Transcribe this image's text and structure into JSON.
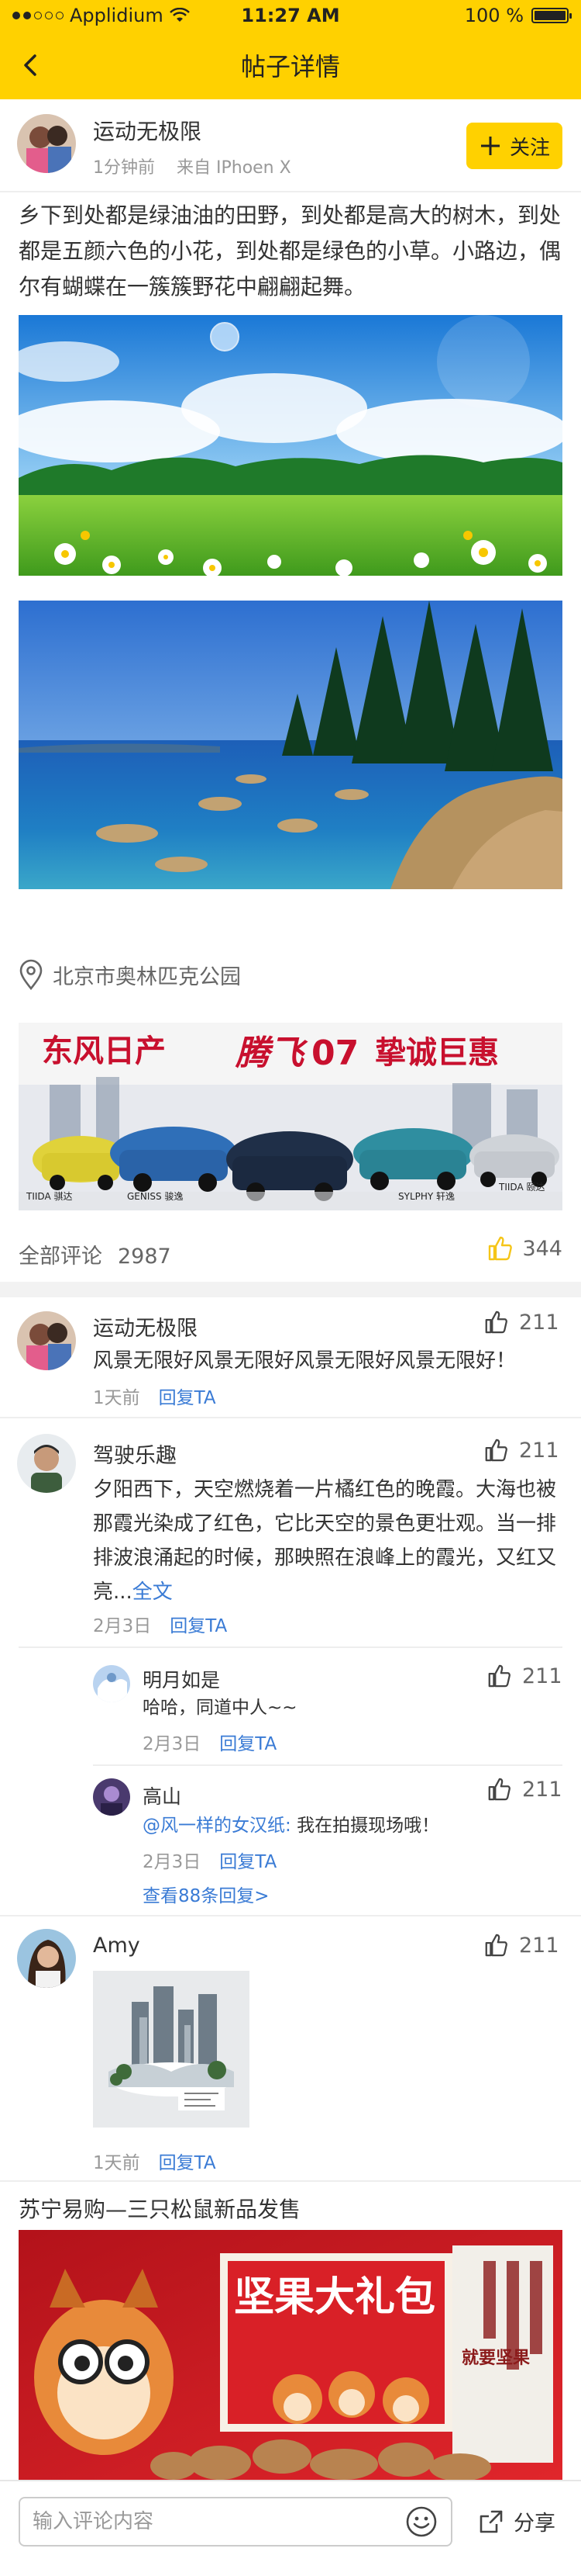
{
  "status": {
    "carrier": "Applidium",
    "time": "11:27 AM",
    "battery": "100 %"
  },
  "nav": {
    "title": "帖子详情"
  },
  "post": {
    "author": "运动无极限",
    "time": "1分钟前",
    "source": "来自 IPhoen X",
    "follow_label": "关注",
    "text": "乡下到处都是绿油油的田野，到处都是高大的树木，到处都是五颜六色的小花，到处都是绿色的小草。小路边，偶尔有蝴蝶在一簇簇野花中翩翩起舞。",
    "location": "北京市奥林匹克公园"
  },
  "ad_banner": {
    "brand": "东风日产",
    "slogan_script": "腾飞",
    "slogan_num": "07",
    "slogan_tail": "挚诚巨惠",
    "car_labels": [
      "TIIDA 骐达",
      "GENISS 骏逸",
      "SYLPHY 轩逸",
      "TIIDA 颐达"
    ]
  },
  "stats": {
    "comments_label": "全部评论",
    "comments_count": "2987",
    "likes": "344"
  },
  "comments": [
    {
      "name": "运动无极限",
      "text": "风景无限好风景无限好风景无限好风景无限好！",
      "time": "1天前",
      "reply_label": "回复TA",
      "likes": "211"
    },
    {
      "name": "驾驶乐趣",
      "text": "夕阳西下，天空燃烧着一片橘红色的晚霞。大海也被那霞光染成了红色，它比天空的景色更壮观。当一排排波浪涌起的时候，那映照在浪峰上的霞光，又红又亮...",
      "more": "全文",
      "time": "2月3日",
      "reply_label": "回复TA",
      "likes": "211",
      "replies": [
        {
          "name": "明月如是",
          "text": "哈哈，同道中人~~",
          "time": "2月3日",
          "reply_label": "回复TA",
          "likes": "211"
        },
        {
          "name": "高山",
          "mention": "@风一样的女汉纸:",
          "text": "我在拍摄现场哦！",
          "time": "2月3日",
          "reply_label": "回复TA",
          "likes": "211"
        }
      ],
      "view_more": "查看88条回复>"
    },
    {
      "name": "Amy",
      "time": "1天前",
      "reply_label": "回复TA",
      "likes": "211"
    }
  ],
  "ad2": {
    "title": "苏宁易购—三只松鼠新品发售",
    "banner_text": "坚果大礼包",
    "side_text": "就要坚果"
  },
  "bottom": {
    "input_placeholder": "输入评论内容",
    "share_label": "分享"
  },
  "colors": {
    "brand_yellow": "#ffd100",
    "link_blue": "#3a7bd5",
    "like_yellow": "#f5c518"
  }
}
